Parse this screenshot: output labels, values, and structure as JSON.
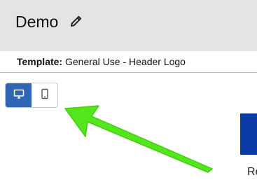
{
  "header": {
    "title": "Demo",
    "edit_icon": "pencil-icon"
  },
  "template_bar": {
    "label": "Template:",
    "value": "General Use - Header Logo"
  },
  "view_toggle": {
    "desktop_icon": "desktop-monitor-icon",
    "mobile_icon": "mobile-phone-icon",
    "selected": "desktop"
  },
  "preview": {
    "partial_text": "Re"
  },
  "colors": {
    "header_bg": "#e4e4e4",
    "active_toggle": "#2f66b3",
    "preview_block": "#0a3aa3",
    "annotation_arrow": "#55e51c"
  }
}
